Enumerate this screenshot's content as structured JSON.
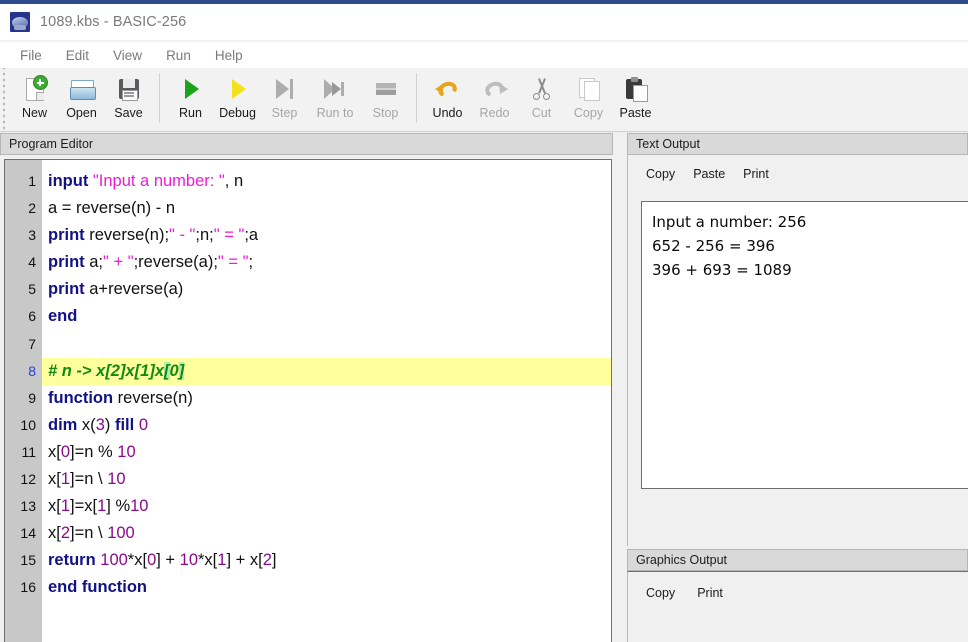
{
  "window": {
    "title": "1089.kbs - BASIC-256",
    "icon": "basic256-app-icon"
  },
  "menubar": {
    "items": [
      {
        "label": "File"
      },
      {
        "label": "Edit"
      },
      {
        "label": "View"
      },
      {
        "label": "Run"
      },
      {
        "label": "Help"
      }
    ]
  },
  "toolbar": {
    "groups": [
      {
        "buttons": [
          {
            "label": "New",
            "icon": "new-file-icon",
            "enabled": true
          },
          {
            "label": "Open",
            "icon": "open-folder-icon",
            "enabled": true
          },
          {
            "label": "Save",
            "icon": "floppy-disk-icon",
            "enabled": true
          }
        ]
      },
      {
        "buttons": [
          {
            "label": "Run",
            "icon": "play-triangle-icon",
            "enabled": true
          },
          {
            "label": "Debug",
            "icon": "play-triangle-yellow-icon",
            "enabled": true
          },
          {
            "label": "Step",
            "icon": "step-over-icon",
            "enabled": false
          },
          {
            "label": "Run to",
            "icon": "run-to-cursor-icon",
            "enabled": false
          },
          {
            "label": "Stop",
            "icon": "stop-square-icon",
            "enabled": false
          }
        ]
      },
      {
        "buttons": [
          {
            "label": "Undo",
            "icon": "undo-arrow-icon",
            "enabled": true
          },
          {
            "label": "Redo",
            "icon": "redo-arrow-icon",
            "enabled": false
          },
          {
            "label": "Cut",
            "icon": "scissors-icon",
            "enabled": false
          },
          {
            "label": "Copy",
            "icon": "copy-pages-icon",
            "enabled": false
          },
          {
            "label": "Paste",
            "icon": "clipboard-icon",
            "enabled": true
          }
        ]
      }
    ]
  },
  "editor": {
    "title": "Program Editor",
    "current_line": 8,
    "lines": [
      {
        "n": 1,
        "text": "input \"Input a number: \", n"
      },
      {
        "n": 2,
        "text": "a = reverse(n) - n"
      },
      {
        "n": 3,
        "text": "print reverse(n);\" - \";n;\" = \";a"
      },
      {
        "n": 4,
        "text": "print a;\" + \";reverse(a);\" = \";"
      },
      {
        "n": 5,
        "text": "print a+reverse(a)"
      },
      {
        "n": 6,
        "text": "end"
      },
      {
        "n": 7,
        "text": ""
      },
      {
        "n": 8,
        "text": "# n -> x[2]x[1]x[0]"
      },
      {
        "n": 9,
        "text": "function reverse(n)"
      },
      {
        "n": 10,
        "text": "dim x(3) fill 0"
      },
      {
        "n": 11,
        "text": "x[0]=n % 10"
      },
      {
        "n": 12,
        "text": "x[1]=n \\ 10"
      },
      {
        "n": 13,
        "text": "x[1]=x[1] %10"
      },
      {
        "n": 14,
        "text": "x[2]=n \\ 100"
      },
      {
        "n": 15,
        "text": "return 100*x[0] + 10*x[1] + x[2]"
      },
      {
        "n": 16,
        "text": "end function"
      }
    ]
  },
  "text_output": {
    "title": "Text Output",
    "buttons": [
      {
        "label": "Copy"
      },
      {
        "label": "Paste"
      },
      {
        "label": "Print"
      }
    ],
    "console": "Input a number: 256\n652 - 256 = 396\n396 + 693 = 1089"
  },
  "graphics_output": {
    "title": "Graphics Output",
    "buttons": [
      {
        "label": "Copy"
      },
      {
        "label": "Print"
      }
    ]
  },
  "colors": {
    "accent": "#2b4b8d",
    "keyword": "#121287",
    "string": "#f01ad8",
    "number": "#8b0a8b",
    "comment": "#128a12",
    "current_line_highlight": "#ffff9e",
    "brace_match": "#b2ecb2",
    "gutter": "#c8c8c8",
    "pane_header": "#d9d9d9"
  }
}
